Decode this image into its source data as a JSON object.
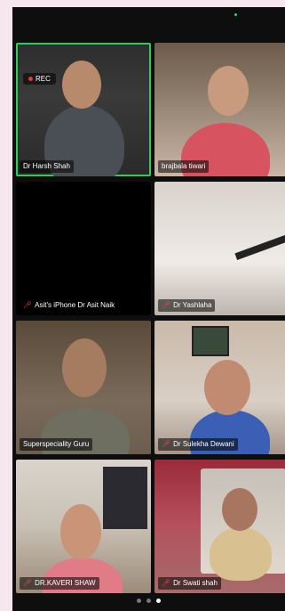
{
  "meeting": {
    "recording_label": "REC",
    "current_page": 3,
    "total_pages": 3
  },
  "participants": [
    {
      "name": "Dr Harsh Shah",
      "muted": false,
      "active_speaker": true
    },
    {
      "name": "brajbala tiwari",
      "muted": false,
      "active_speaker": false
    },
    {
      "name": "Asit's iPhone Dr Asit Naik",
      "muted": true,
      "active_speaker": false
    },
    {
      "name": "Dr Yashlaha",
      "muted": true,
      "active_speaker": false
    },
    {
      "name": "Superspeciality Guru",
      "muted": false,
      "active_speaker": false
    },
    {
      "name": "Dr Sulekha Dewani",
      "muted": true,
      "active_speaker": false
    },
    {
      "name": "DR.KAVERI SHAW",
      "muted": true,
      "active_speaker": false
    },
    {
      "name": "Dr Swati shah",
      "muted": true,
      "active_speaker": false
    }
  ],
  "colors": {
    "active_border": "#2ecc5a",
    "muted_mic": "#ff4a4a",
    "rec_dot": "#e53935"
  }
}
